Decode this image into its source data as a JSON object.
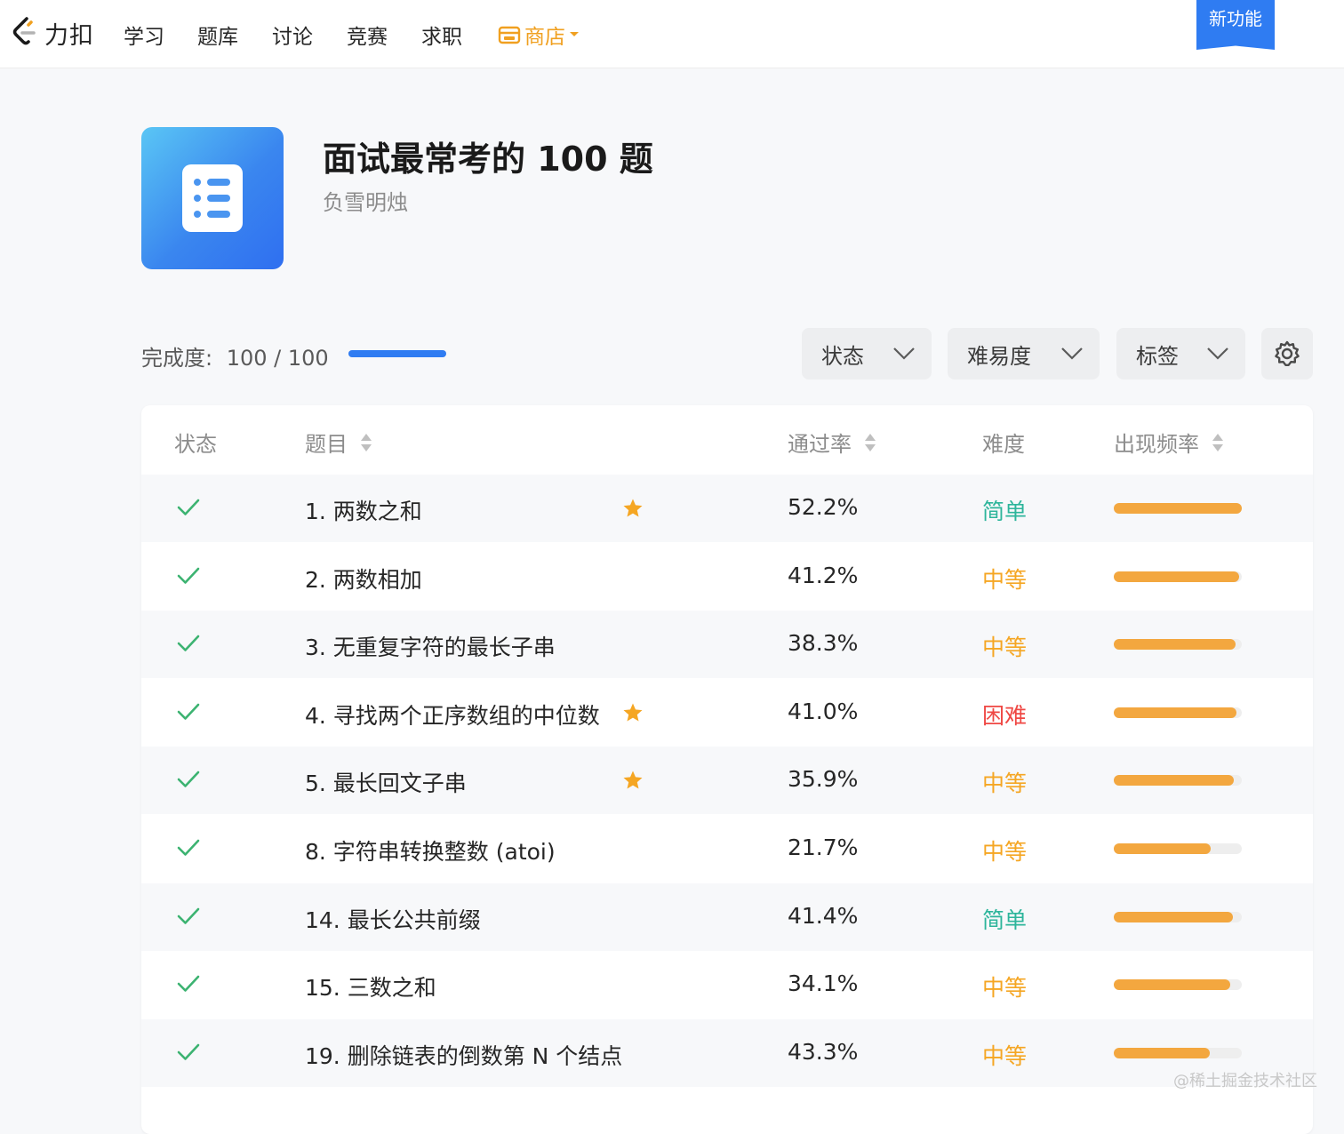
{
  "nav": {
    "brand": "力扣",
    "items": [
      "学习",
      "题库",
      "讨论",
      "竞赛",
      "求职"
    ],
    "store_label": "商店",
    "new_feature_label": "新功能",
    "accent": "#f0a020"
  },
  "list": {
    "title": "面试最常考的 100 题",
    "author": "负雪明烛"
  },
  "progress": {
    "label": "完成度:",
    "value_text": "100 / 100",
    "completed": 100,
    "total": 100,
    "fraction": 1.0
  },
  "filters": [
    "状态",
    "难易度",
    "标签"
  ],
  "table": {
    "headers": {
      "status": "状态",
      "title": "题目",
      "acceptance": "通过率",
      "difficulty": "难度",
      "frequency": "出现频率"
    },
    "rows": [
      {
        "title": "1. 两数之和",
        "starred": true,
        "acceptance": "52.2%",
        "difficulty": "简单",
        "level": "easy",
        "frequency": 1.0
      },
      {
        "title": "2. 两数相加",
        "starred": false,
        "acceptance": "41.2%",
        "difficulty": "中等",
        "level": "medium",
        "frequency": 0.98
      },
      {
        "title": "3. 无重复字符的最长子串",
        "starred": false,
        "acceptance": "38.3%",
        "difficulty": "中等",
        "level": "medium",
        "frequency": 0.95
      },
      {
        "title": "4. 寻找两个正序数组的中位数",
        "starred": true,
        "acceptance": "41.0%",
        "difficulty": "困难",
        "level": "hard",
        "frequency": 0.96
      },
      {
        "title": "5. 最长回文子串",
        "starred": true,
        "acceptance": "35.9%",
        "difficulty": "中等",
        "level": "medium",
        "frequency": 0.94
      },
      {
        "title": "8. 字符串转换整数 (atoi)",
        "starred": false,
        "acceptance": "21.7%",
        "difficulty": "中等",
        "level": "medium",
        "frequency": 0.76
      },
      {
        "title": "14. 最长公共前缀",
        "starred": false,
        "acceptance": "41.4%",
        "difficulty": "简单",
        "level": "easy",
        "frequency": 0.93
      },
      {
        "title": "15. 三数之和",
        "starred": false,
        "acceptance": "34.1%",
        "difficulty": "中等",
        "level": "medium",
        "frequency": 0.91
      },
      {
        "title": "19. 删除链表的倒数第 N 个结点",
        "starred": false,
        "acceptance": "43.3%",
        "difficulty": "中等",
        "level": "medium",
        "frequency": 0.75
      }
    ]
  },
  "colors": {
    "easy": "#2db59b",
    "medium": "#f5a623",
    "hard": "#ef4743",
    "check": "#3cb371",
    "star": "#f5a623",
    "frequency_bar": "#f3a73f",
    "progress_bar": "#2f7cf2"
  },
  "watermark": "@稀土掘金技术社区"
}
